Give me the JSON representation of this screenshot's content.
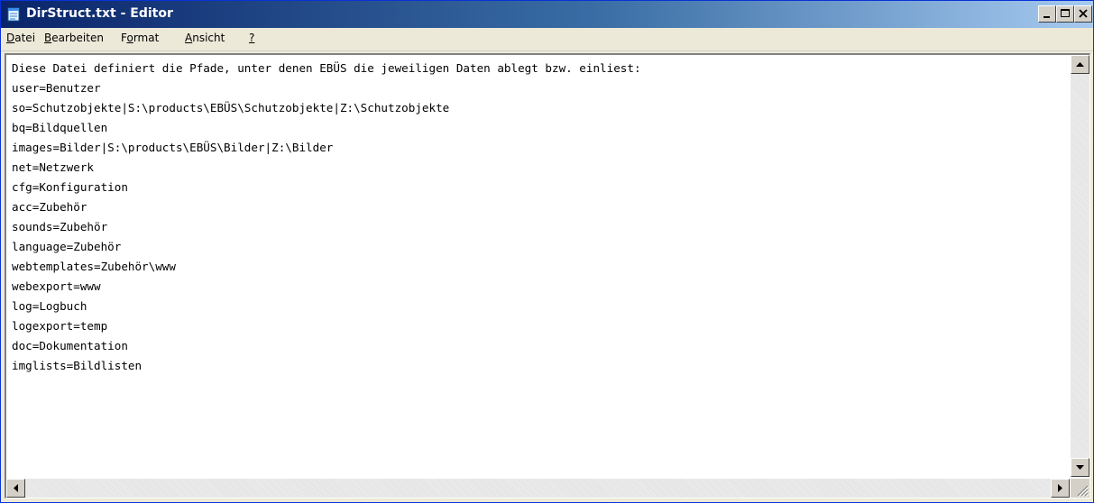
{
  "window": {
    "title": "DirStruct.txt - Editor"
  },
  "menu": [
    {
      "key": "D",
      "rest": "atei"
    },
    {
      "key": "B",
      "rest": "earbeiten"
    },
    {
      "pre": "F",
      "key": "o",
      "rest": "rmat"
    },
    {
      "key": "A",
      "rest": "nsicht"
    },
    {
      "key": "?",
      "rest": ""
    }
  ],
  "editor": {
    "lines": [
      "Diese Datei definiert die Pfade, unter denen EBÜS die jeweiligen Daten ablegt bzw. einliest:",
      "user=Benutzer",
      "so=Schutzobjekte|S:\\products\\EBÜS\\Schutzobjekte|Z:\\Schutzobjekte",
      "bq=Bildquellen",
      "images=Bilder|S:\\products\\EBÜS\\Bilder|Z:\\Bilder",
      "net=Netzwerk",
      "cfg=Konfiguration",
      "acc=Zubehör",
      "sounds=Zubehör",
      "language=Zubehör",
      "webtemplates=Zubehör\\www",
      "webexport=www",
      "log=Logbuch",
      "logexport=temp",
      "doc=Dokumentation",
      "imglists=Bildlisten"
    ]
  }
}
